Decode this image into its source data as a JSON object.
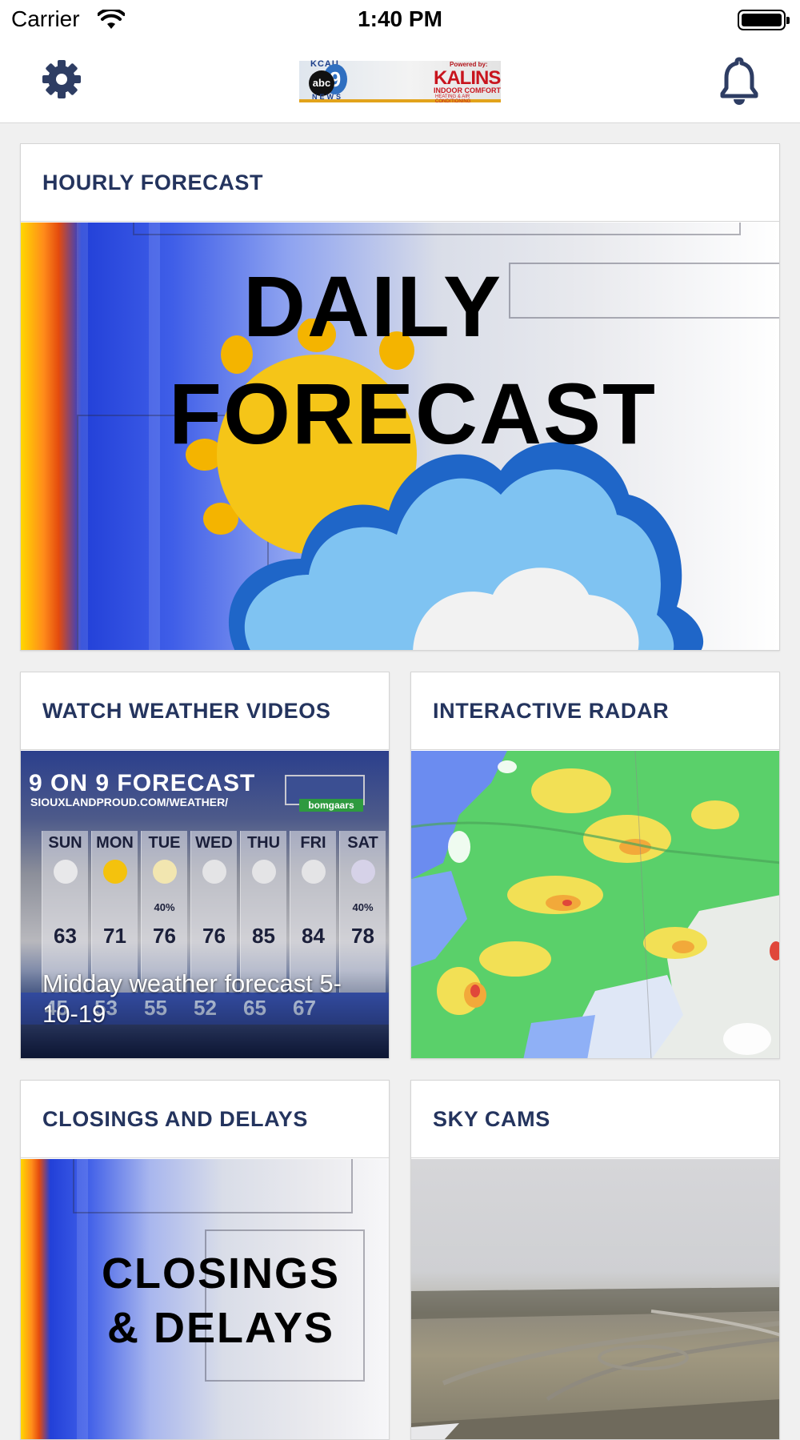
{
  "status_bar": {
    "carrier": "Carrier",
    "time": "1:40 PM"
  },
  "nav": {
    "left_icon": "gear-icon",
    "right_icon": "bell-icon",
    "logo": {
      "kcau": "KCAU",
      "abc": "abc",
      "nine": "9",
      "news": "NEWS",
      "powered": "Powered by:",
      "kalins": "KALINS",
      "indoor": "INDOOR COMFORT",
      "heating": "HEATING & AIR CONDITIONING"
    }
  },
  "cards": {
    "hourly": {
      "title": "HOURLY FORECAST",
      "image_line1": "DAILY",
      "image_line2": "FORECAST"
    },
    "videos": {
      "title": "WATCH WEATHER VIDEOS",
      "caption": "Midday weather forecast 5-10-19",
      "graphic": {
        "heading": "9 ON 9 FORECAST",
        "url": "SIOUXLANDPROUD.COM/WEATHER/",
        "sponsor": "bomgaars",
        "days": [
          "SUN",
          "MON",
          "TUE",
          "WED",
          "THU",
          "FRI",
          "SAT"
        ],
        "highs": [
          "63",
          "71",
          "76",
          "76",
          "85",
          "84",
          "78"
        ],
        "lows": [
          "45",
          "53",
          "55",
          "52",
          "65",
          "67"
        ],
        "precip": {
          "TUE": "40%",
          "SAT": "40%"
        }
      }
    },
    "radar": {
      "title": "INTERACTIVE RADAR"
    },
    "closings": {
      "title": "CLOSINGS AND DELAYS",
      "image_line1": "CLOSINGS",
      "image_line2": "& DELAYS"
    },
    "skycams": {
      "title": "SKY CAMS"
    }
  },
  "colors": {
    "title_text": "#24345e",
    "card_border": "#d5d5d5",
    "background": "#f0f0f0",
    "icon": "#2e3d63"
  }
}
